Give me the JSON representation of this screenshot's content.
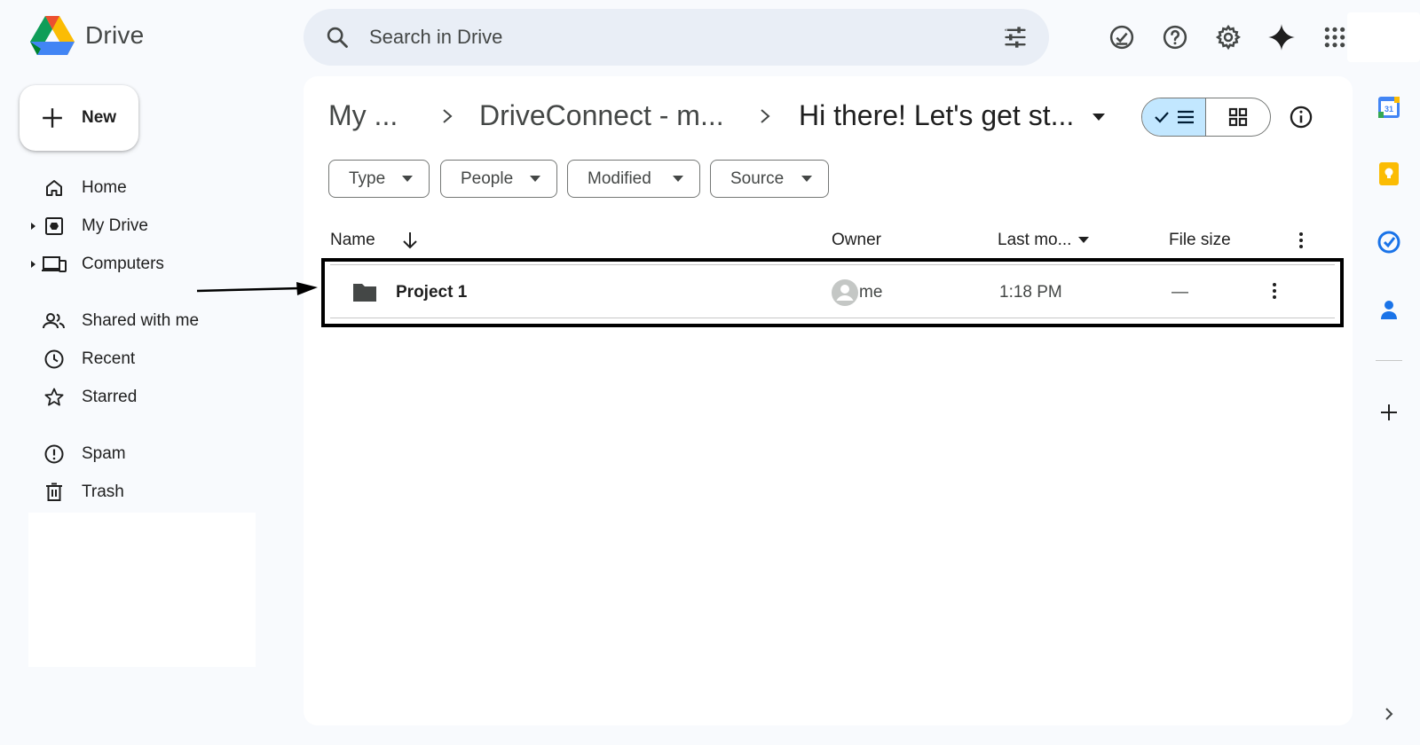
{
  "app": {
    "name": "Drive"
  },
  "search": {
    "placeholder": "Search in Drive"
  },
  "header_icons": [
    "ready-for-offline-icon",
    "help-icon",
    "settings-icon",
    "gemini-icon",
    "apps-grid-icon"
  ],
  "new_button": {
    "label": "New"
  },
  "sidebar": {
    "items": [
      {
        "label": "Home",
        "icon": "home-icon",
        "expandable": false
      },
      {
        "label": "My Drive",
        "icon": "my-drive-icon",
        "expandable": true
      },
      {
        "label": "Computers",
        "icon": "computers-icon",
        "expandable": true
      },
      {
        "label": "Shared with me",
        "icon": "shared-icon",
        "expandable": false
      },
      {
        "label": "Recent",
        "icon": "clock-icon",
        "expandable": false
      },
      {
        "label": "Starred",
        "icon": "star-icon",
        "expandable": false
      },
      {
        "label": "Spam",
        "icon": "spam-icon",
        "expandable": false
      },
      {
        "label": "Trash",
        "icon": "trash-icon",
        "expandable": false
      }
    ]
  },
  "breadcrumb": {
    "items": [
      "My ...",
      "DriveConnect - m...",
      "Hi there! Let's get st..."
    ]
  },
  "view_toggle": {
    "active": "list"
  },
  "filters": [
    "Type",
    "People",
    "Modified",
    "Source"
  ],
  "table": {
    "columns": {
      "name": "Name",
      "owner": "Owner",
      "modified": "Last mo...",
      "size": "File size"
    },
    "sort": "name-descending",
    "rows": [
      {
        "name": "Project 1",
        "type": "folder",
        "owner": "me",
        "modified": "1:18 PM",
        "size": "—"
      }
    ]
  },
  "right_panel": {
    "apps": [
      "calendar-icon",
      "keep-icon",
      "tasks-icon",
      "contacts-icon"
    ],
    "calendar_day": "31"
  },
  "colors": {
    "background": "#f8fafd",
    "search_bg": "#e9eef6",
    "toggle_active": "#c2e7ff",
    "highlight_border": "#000000"
  }
}
